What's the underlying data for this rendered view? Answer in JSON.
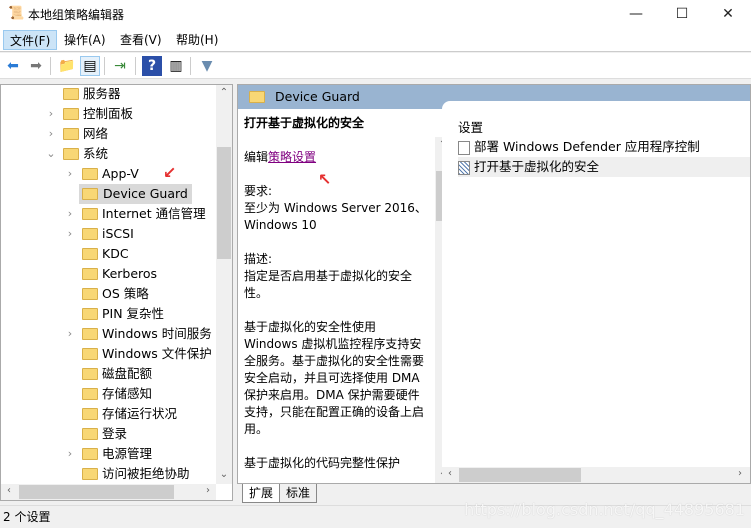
{
  "window": {
    "title": "本地组策略编辑器",
    "minimize": "—",
    "maximize": "☐",
    "close": "✕"
  },
  "menu": [
    "文件(F)",
    "操作(A)",
    "查看(V)",
    "帮助(H)"
  ],
  "toolbar": [
    "back-icon",
    "forward-icon",
    "up-folder-icon",
    "show-hide-tree-icon",
    "export-list-icon",
    "help-icon",
    "show-action-pane-icon",
    "filter-icon"
  ],
  "tree": [
    {
      "label": "服务器",
      "level": 1,
      "expander": ""
    },
    {
      "label": "控制面板",
      "level": 1,
      "expander": "›"
    },
    {
      "label": "网络",
      "level": 1,
      "expander": "›"
    },
    {
      "label": "系统",
      "level": 1,
      "expander": "⌄"
    },
    {
      "label": "App-V",
      "level": 2,
      "expander": "›"
    },
    {
      "label": "Device Guard",
      "level": 2,
      "expander": "",
      "selected": true
    },
    {
      "label": "Internet 通信管理",
      "level": 2,
      "expander": "›"
    },
    {
      "label": "iSCSI",
      "level": 2,
      "expander": "›"
    },
    {
      "label": "KDC",
      "level": 2,
      "expander": ""
    },
    {
      "label": "Kerberos",
      "level": 2,
      "expander": ""
    },
    {
      "label": "OS 策略",
      "level": 2,
      "expander": ""
    },
    {
      "label": "PIN 复杂性",
      "level": 2,
      "expander": ""
    },
    {
      "label": "Windows 时间服务",
      "level": 2,
      "expander": "›"
    },
    {
      "label": "Windows 文件保护",
      "level": 2,
      "expander": ""
    },
    {
      "label": "磁盘配额",
      "level": 2,
      "expander": ""
    },
    {
      "label": "存储感知",
      "level": 2,
      "expander": ""
    },
    {
      "label": "存储运行状况",
      "level": 2,
      "expander": ""
    },
    {
      "label": "登录",
      "level": 2,
      "expander": ""
    },
    {
      "label": "电源管理",
      "level": 2,
      "expander": "›"
    },
    {
      "label": "访问被拒绝协助",
      "level": 2,
      "expander": ""
    }
  ],
  "header": {
    "title": "Device Guard"
  },
  "description": {
    "title": "打开基于虚拟化的安全",
    "edit_prefix": "编辑",
    "edit_link": "策略设置",
    "req_label": "要求:",
    "req_text": "至少为 Windows Server 2016、Windows 10",
    "desc_label": "描述:",
    "desc_text": "指定是否启用基于虚拟化的安全性。",
    "para1": "基于虚拟化的安全性使用 Windows 虚拟机监控程序支持安全服务。基于虚拟化的安全性需要安全启动，并且可选择使用 DMA 保护来启用。DMA 保护需要硬件支持，只能在配置正确的设备上启用。",
    "para2": "基于虚拟化的代码完整性保护"
  },
  "settings": {
    "column": "设置",
    "items": [
      {
        "label": "部署 Windows Defender 应用程序控制",
        "icon": "policy-setting-icon"
      },
      {
        "label": "打开基于虚拟化的安全",
        "icon": "policy-setting-selected-icon",
        "selected": true
      }
    ]
  },
  "tabs": [
    "扩展",
    "标准"
  ],
  "status": "2 个设置",
  "watermark": "https://blog.csdn.net/qq_44895681",
  "colors": {
    "header": "#99b4d1",
    "link": "#800080",
    "annotation": "#e53030"
  }
}
